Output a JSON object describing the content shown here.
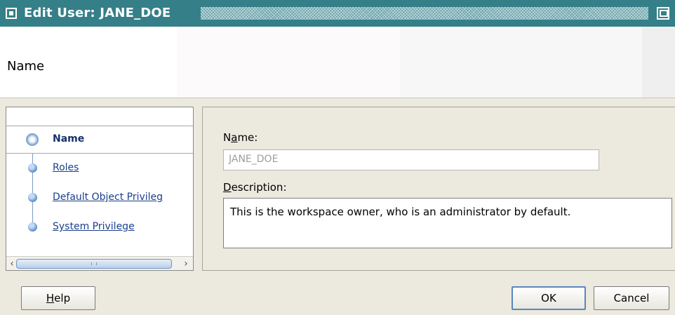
{
  "window": {
    "title": "Edit User: JANE_DOE"
  },
  "header": {
    "title": "Name"
  },
  "nav": {
    "items": [
      {
        "label": "Name",
        "state": "current"
      },
      {
        "label": "Roles",
        "state": "link"
      },
      {
        "label": "Default Object Privileg",
        "state": "link"
      },
      {
        "label": "System Privilege",
        "state": "link"
      }
    ]
  },
  "form": {
    "name_label_pre": "N",
    "name_label_mnemonic": "a",
    "name_label_post": "me:",
    "name_value": "JANE_DOE",
    "description_label_mnemonic": "D",
    "description_label_post": "escription:",
    "description_value": "This is the workspace owner, who is an administrator by default."
  },
  "buttons": {
    "help_mnemonic": "H",
    "help_rest": "elp",
    "ok": "OK",
    "cancel": "Cancel"
  },
  "colors": {
    "titlebar": "#357f88",
    "link": "#1b3f8b",
    "background": "#ece9df"
  }
}
